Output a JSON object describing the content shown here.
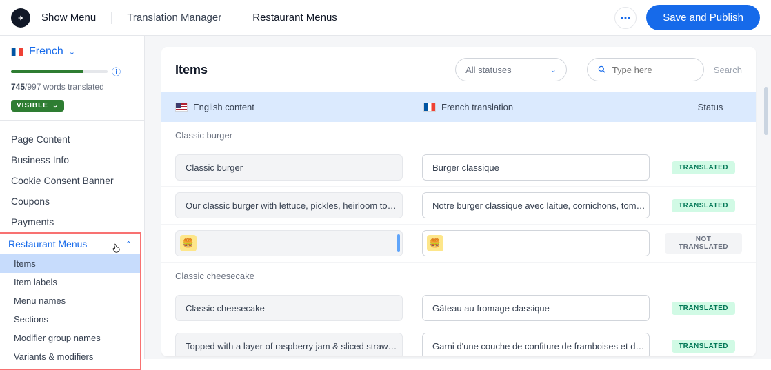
{
  "topbar": {
    "show_menu": "Show Menu",
    "crumb1": "Translation Manager",
    "crumb2": "Restaurant Menus",
    "save_label": "Save and Publish"
  },
  "sidebar": {
    "language": "French",
    "words_done": "745",
    "words_total": "997",
    "words_suffix": " words translated",
    "visible_label": "VISIBLE",
    "nav": [
      "Page Content",
      "Business Info",
      "Cookie Consent Banner",
      "Coupons",
      "Payments"
    ],
    "collapsible": {
      "parent": "Restaurant Menus",
      "items": [
        "Items",
        "Item labels",
        "Menu names",
        "Sections",
        "Modifier group names",
        "Variants & modifiers"
      ]
    }
  },
  "panel": {
    "title": "Items",
    "status_filter": "All statuses",
    "search_placeholder": "Type here",
    "search_action": "Search",
    "head_en": "English content",
    "head_fr": "French translation",
    "head_status": "Status",
    "sections": [
      {
        "title": "Classic burger",
        "rows": [
          {
            "en": "Classic burger",
            "fr": "Burger classique",
            "status": "TRANSLATED",
            "type": "text"
          },
          {
            "en": "Our classic burger with lettuce, pickles, heirloom to…",
            "fr": "Notre burger classique avec laitue, cornichons, tom…",
            "status": "TRANSLATED",
            "type": "text"
          },
          {
            "en": "🍔",
            "fr": "🍔",
            "status": "NOT TRANSLATED",
            "type": "image"
          }
        ]
      },
      {
        "title": "Classic cheesecake",
        "rows": [
          {
            "en": "Classic cheesecake",
            "fr": "Gâteau au fromage classique",
            "status": "TRANSLATED",
            "type": "text"
          },
          {
            "en": "Topped with a layer of raspberry jam & sliced straw…",
            "fr": "Garni d'une couche de confiture de framboises et d…",
            "status": "TRANSLATED",
            "type": "text"
          }
        ]
      }
    ]
  }
}
